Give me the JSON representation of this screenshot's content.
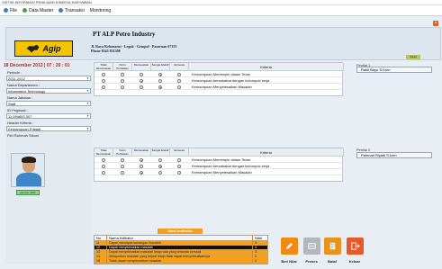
{
  "window": {
    "title": "SISTIM INFORMASI PENILAIAN KINERJA KARYAWAN"
  },
  "menubar": {
    "items": [
      {
        "label": "File",
        "icon": "file-icon"
      },
      {
        "label": "Data Master",
        "icon": "globe-icon"
      },
      {
        "label": "Transaksi",
        "icon": "table-icon"
      },
      {
        "label": "Monitoring",
        "icon": ""
      }
    ]
  },
  "header": {
    "brand": "Agip",
    "company": "PT ALP Petro Industry",
    "address": "Jl. Raya Kebonarut - Legok - Gempol - Pasuruan 67155",
    "phone": "Phone 0343 851308",
    "badge": "Clean"
  },
  "left": {
    "datetime": "18 December 2012 | 07 : 26 : 01",
    "fields": [
      {
        "label": "Periode :",
        "value": "2011-2012"
      },
      {
        "label": "Nama Departemen :",
        "value": "Information Technology"
      },
      {
        "label": "Nama Jabatan :",
        "value": "Staff"
      },
      {
        "label": "ID Pegawai :",
        "value": "11.094693.007"
      },
      {
        "label": "Header Kriteria :",
        "value": "Kemampuan Pribadi"
      }
    ],
    "employee_name": "Fitri Rahmah Sikum",
    "photo_caption": "gambar diklik"
  },
  "grid_headers": [
    "Tidak Memuaskan",
    "Perlu Perbaikan",
    "Memuaskan",
    "Sangat Efektif",
    "Istimewa",
    "Kriteria"
  ],
  "grid1": {
    "penilai_label": "Penilai 1",
    "penilai_value": "Rakit Bayu S.Kom",
    "rows": [
      {
        "kriteria": "Kemampuan Memimpin dalam Team",
        "selected": 3
      },
      {
        "kriteria": "Kemampuan bersahabat dengan kelompok kerja",
        "selected": 2
      },
      {
        "kriteria": "Kemampuan Menyelesaikan Masalah",
        "selected": 3
      }
    ]
  },
  "grid2": {
    "penilai_label": "Penilai 2",
    "penilai_value": "Pahmad Riyadi S.kom",
    "rows": [
      {
        "kriteria": "Kemampuan Memimpin dalam Team",
        "selected": 2
      },
      {
        "kriteria": "Kemampuan bersahabat dengan kelompok kerja",
        "selected": 3
      },
      {
        "kriteria": "Kemampuan Menyelesaikan Masalah",
        "selected": 2
      }
    ]
  },
  "indicator": {
    "title": "Tabel Indikator",
    "headers": {
      "no": "No",
      "name": "Nama indikator",
      "nilai": "Nilai"
    },
    "rows": [
      {
        "no": "11",
        "name": "Dapat mencapai tantangan masalah",
        "nilai": "5"
      },
      {
        "no": "12",
        "name": "Dapat menyelesaikan masalah",
        "nilai": "4"
      },
      {
        "no": "13",
        "name": "Dapat menyelesaikan masalah tetapi ada yang tertunda kembali",
        "nilai": "3"
      },
      {
        "no": "14",
        "name": "Melaporkan masalah yang terjadi tetapi tidak dapat menyelesaikannya",
        "nilai": "2"
      },
      {
        "no": "15",
        "name": "Tidak dapat menyelesaikan masalah",
        "nilai": "1"
      }
    ]
  },
  "actions": [
    {
      "label": "Beri Nilai",
      "icon": "pencil-icon"
    },
    {
      "label": "Proses",
      "icon": "process-icon"
    },
    {
      "label": "Batal",
      "icon": "cancel-icon"
    },
    {
      "label": "Keluar",
      "icon": "exit-icon"
    }
  ],
  "colors": {
    "accent": "#F39E1F",
    "datetime": "#D61A1A",
    "logo": "#F5C400"
  }
}
